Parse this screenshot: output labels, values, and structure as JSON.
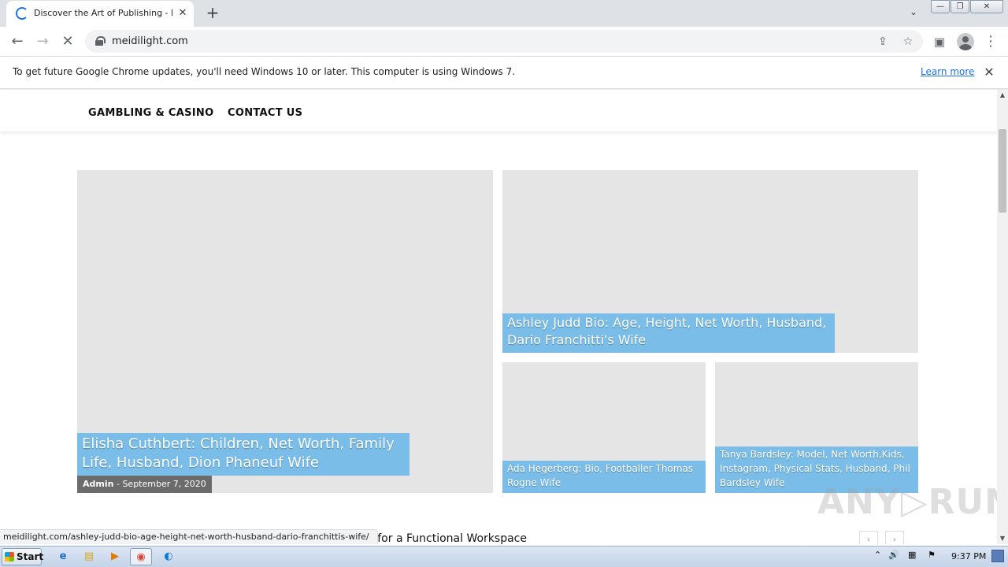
{
  "browser": {
    "tab_title": "Discover the Art of Publishing - Meidilight",
    "tab_close": "✕",
    "new_tab": "+",
    "tab_search": "⌄",
    "window_controls": {
      "minimize": "—",
      "restore": "❐",
      "close": "✕"
    },
    "back": "←",
    "forward": "→",
    "stop": "✕",
    "url": "meidilight.com",
    "share_icon": "⇪",
    "bookmark_icon": "☆",
    "sidepanel_icon": "▣",
    "menu_icon": "⋮"
  },
  "infobar": {
    "message": "To get future Google Chrome updates, you'll need Windows 10 or later. This computer is using Windows 7.",
    "link": "Learn more",
    "close": "✕"
  },
  "site": {
    "nav": [
      "GAMBLING & CASINO",
      "CONTACT US"
    ],
    "featured": {
      "title": "Elisha Cuthbert: Children, Net Worth, Family Life, Husband, Dion Phaneuf Wife",
      "author": "Admin",
      "separator": "-",
      "date": "September 7, 2020"
    },
    "card_top_right": {
      "title": "Ashley Judd Bio: Age, Height, Net Worth, Husband, Dario Franchitti's Wife"
    },
    "card_small_1": {
      "title": "Ada Hegerberg: Bio, Footballer Thomas Rogne Wife"
    },
    "card_small_2": {
      "title": "Tanya Bardsley: Model, Net Worth,Kids, Instagram, Physical Stats, Husband, Phil Bardsley Wife"
    },
    "bottom_title": "on: Tips for a Functional Workspace",
    "prev": "‹",
    "next": "›"
  },
  "status_url": "meidilight.com/ashley-judd-bio-age-height-net-worth-husband-dario-franchittis-wife/",
  "watermark": "ANY▷RUN",
  "scrollbar": {
    "up": "▲",
    "down": "▼"
  },
  "taskbar": {
    "start": "Start",
    "apps": [
      {
        "name": "ie",
        "icon": "e",
        "color": "#1f6fd0"
      },
      {
        "name": "explorer",
        "icon": "▤",
        "color": "#d9a520"
      },
      {
        "name": "media",
        "icon": "▶",
        "color": "#e07b00"
      },
      {
        "name": "chrome",
        "icon": "◉",
        "color": "#db4437"
      },
      {
        "name": "edge",
        "icon": "◐",
        "color": "#0c7cd5"
      }
    ],
    "tray_icons": [
      "⌃",
      "🔊",
      "▦",
      "⚑"
    ],
    "clock": "9:37 PM"
  }
}
